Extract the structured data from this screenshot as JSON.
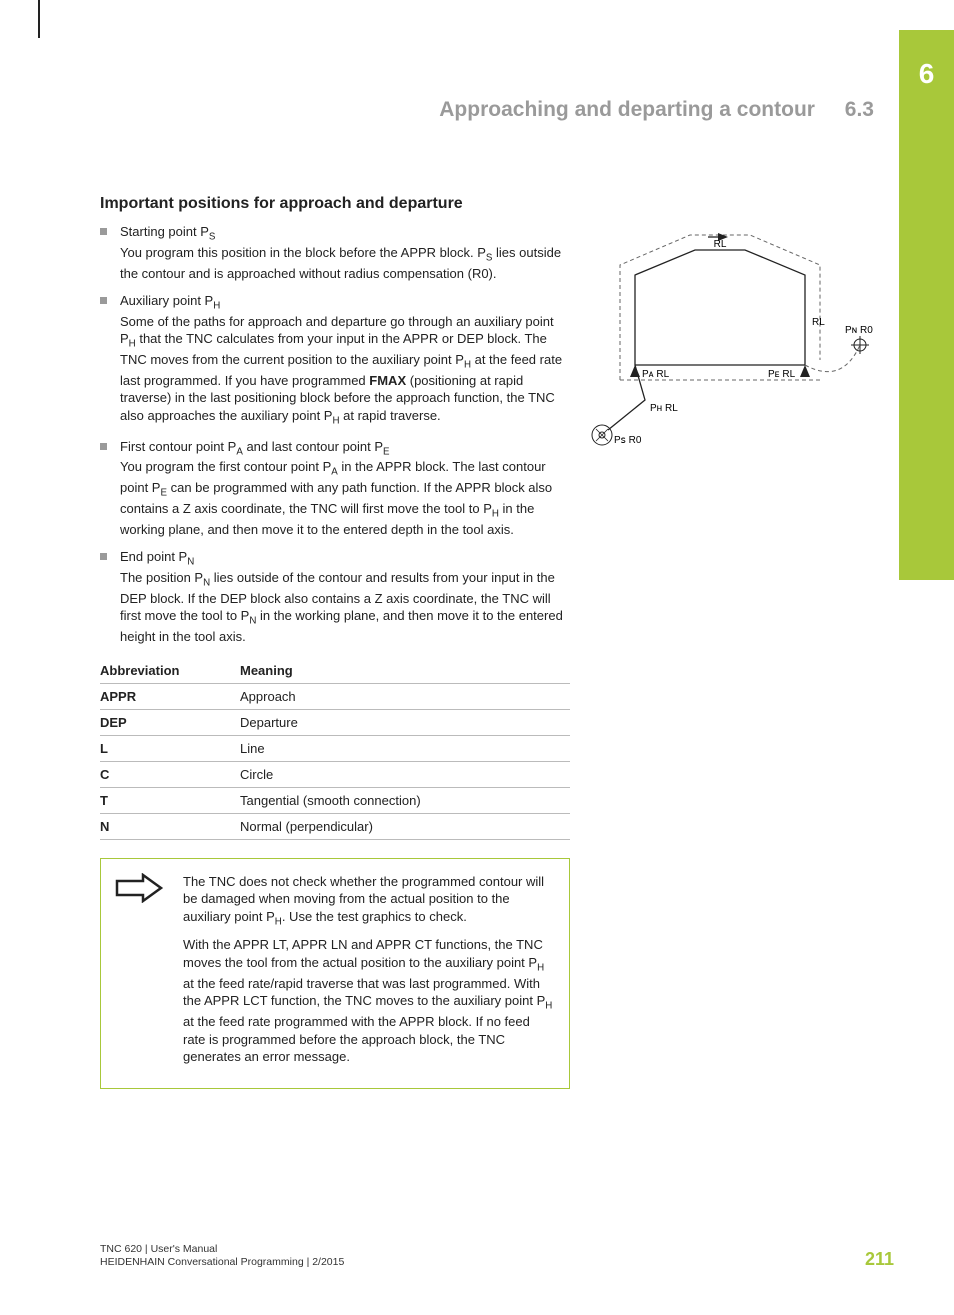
{
  "chapter_number": "6",
  "header": {
    "title": "Approaching and departing a contour",
    "section": "6.3"
  },
  "heading": "Important positions for approach and departure",
  "bullets": [
    {
      "title_html": "Starting point P<sub>S</sub>",
      "body_html": "You program this position in the block before the APPR block. P<sub>S</sub> lies outside the contour and is approached without radius compensation (R0)."
    },
    {
      "title_html": "Auxiliary point P<sub>H</sub>",
      "body_html": "Some of the paths for approach and departure go through an auxiliary point P<sub>H</sub> that the TNC calculates from your input in the APPR or DEP block. The TNC moves from the current position to the auxiliary point P<sub>H</sub> at the feed rate last programmed. If you have programmed <b>FMAX</b> (positioning at rapid traverse) in the last positioning block before the approach function, the TNC also approaches the auxiliary point P<sub>H</sub> at rapid traverse."
    },
    {
      "title_html": "First contour point P<sub>A</sub> and last contour point P<sub>E</sub>",
      "body_html": "You program the first contour point P<sub>A</sub> in the APPR block. The last contour point P<sub>E</sub> can be programmed with any path function. If the APPR block also contains a Z axis coordinate, the TNC will first move the tool to P<sub>H</sub> in the working plane, and then move it to the entered depth in the tool axis."
    },
    {
      "title_html": "End point P<sub>N</sub>",
      "body_html": "The position P<sub>N</sub> lies outside of the contour and results from your input in the DEP block. If the DEP block also contains a Z axis coordinate, the TNC will first move the tool to P<sub>N</sub> in the working plane, and then move it to the entered height in the tool axis."
    }
  ],
  "table": {
    "head": [
      "Abbreviation",
      "Meaning"
    ],
    "rows": [
      [
        "APPR",
        "Approach"
      ],
      [
        "DEP",
        "Departure"
      ],
      [
        "L",
        "Line"
      ],
      [
        "C",
        "Circle"
      ],
      [
        "T",
        "Tangential (smooth connection)"
      ],
      [
        "N",
        "Normal (perpendicular)"
      ]
    ]
  },
  "note": {
    "p1_html": "The TNC does not check whether the programmed contour will be damaged when moving from the actual position to the auxiliary point P<sub>H</sub>. Use the test graphics to check.",
    "p2_html": "With the APPR LT, APPR LN and APPR CT functions, the TNC moves the tool from the actual position to the auxiliary point P<sub>H</sub> at the feed rate/rapid traverse that was last programmed. With the APPR LCT function, the TNC moves to the auxiliary point P<sub>H</sub> at the feed rate programmed with the APPR block. If no feed rate is programmed before the approach block, the TNC generates an error message."
  },
  "figure_labels": {
    "rl_top": "RL",
    "rl_right": "RL",
    "pa_rl": "Pᴀ RL",
    "pe_rl": "Pᴇ RL",
    "pn_r0": "Pɴ R0",
    "ph_rl": "Pʜ RL",
    "ps_r0": "Pꜱ R0"
  },
  "footer": {
    "line1": "TNC 620 | User's Manual",
    "line2": "HEIDENHAIN Conversational Programming | 2/2015",
    "page": "211"
  }
}
